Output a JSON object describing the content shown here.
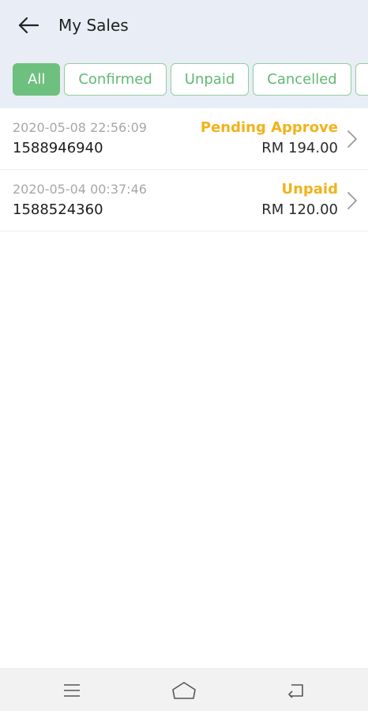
{
  "header": {
    "title": "My Sales",
    "back_icon": "arrow-left-icon"
  },
  "tabs": [
    {
      "label": "All",
      "active": true
    },
    {
      "label": "Confirmed",
      "active": false
    },
    {
      "label": "Unpaid",
      "active": false
    },
    {
      "label": "Cancelled",
      "active": false
    },
    {
      "label": "",
      "active": false
    }
  ],
  "orders": [
    {
      "datetime": "2020-05-08 22:56:09",
      "order_id": "1588946940",
      "status": "Pending Approve",
      "amount": "RM 194.00"
    },
    {
      "datetime": "2020-05-04 00:37:46",
      "order_id": "1588524360",
      "status": "Unpaid",
      "amount": "RM 120.00"
    }
  ],
  "colors": {
    "accent_green": "#6dc07e",
    "status_orange": "#f2b21b",
    "header_bg": "#e9edf6"
  },
  "system_nav": {
    "icons": [
      "menu-icon",
      "home-icon",
      "back-icon"
    ]
  }
}
